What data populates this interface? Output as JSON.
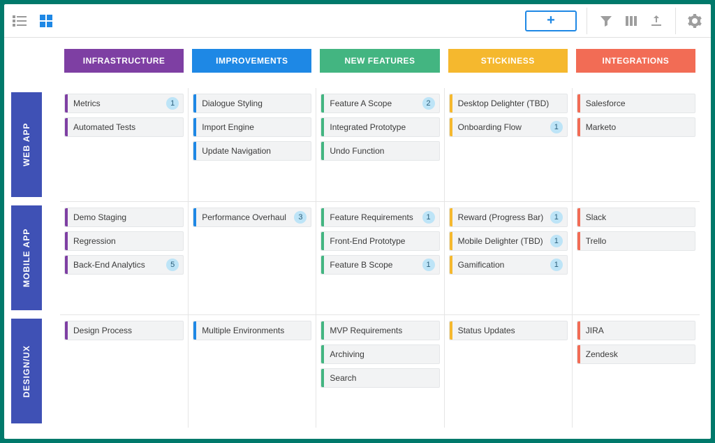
{
  "colors": {
    "infrastructure": "#7e3fa3",
    "improvements": "#1e88e5",
    "newfeatures": "#43b581",
    "stickiness": "#f5b82e",
    "integrations": "#f26c55",
    "rowHeader": "#3f51b5",
    "badgeBg": "#bde4f7"
  },
  "toolbar": {
    "add_label": "+"
  },
  "columns": [
    {
      "id": "infrastructure",
      "label": "INFRASTRUCTURE"
    },
    {
      "id": "improvements",
      "label": "IMPROVEMENTS"
    },
    {
      "id": "newfeatures",
      "label": "NEW FEATURES"
    },
    {
      "id": "stickiness",
      "label": "STICKINESS"
    },
    {
      "id": "integrations",
      "label": "INTEGRATIONS"
    }
  ],
  "rows": [
    {
      "id": "webapp",
      "label": "WEB APP"
    },
    {
      "id": "mobileapp",
      "label": "MOBILE APP"
    },
    {
      "id": "designux",
      "label": "DESIGN/UX"
    }
  ],
  "cards": {
    "webapp": {
      "infrastructure": [
        {
          "label": "Metrics",
          "badge": "1"
        },
        {
          "label": "Automated Tests"
        }
      ],
      "improvements": [
        {
          "label": "Dialogue Styling"
        },
        {
          "label": "Import Engine"
        },
        {
          "label": "Update Navigation"
        }
      ],
      "newfeatures": [
        {
          "label": "Feature A Scope",
          "badge": "2"
        },
        {
          "label": "Integrated Prototype"
        },
        {
          "label": "Undo Function"
        }
      ],
      "stickiness": [
        {
          "label": "Desktop Delighter (TBD)"
        },
        {
          "label": "Onboarding Flow",
          "badge": "1"
        }
      ],
      "integrations": [
        {
          "label": "Salesforce"
        },
        {
          "label": "Marketo"
        }
      ]
    },
    "mobileapp": {
      "infrastructure": [
        {
          "label": "Demo Staging"
        },
        {
          "label": "Regression"
        },
        {
          "label": "Back-End Analytics",
          "badge": "5"
        }
      ],
      "improvements": [
        {
          "label": "Performance Overhaul",
          "badge": "3"
        }
      ],
      "newfeatures": [
        {
          "label": "Feature Requirements",
          "badge": "1"
        },
        {
          "label": "Front-End Prototype"
        },
        {
          "label": "Feature B Scope",
          "badge": "1"
        }
      ],
      "stickiness": [
        {
          "label": "Reward (Progress Bar)",
          "badge": "1"
        },
        {
          "label": "Mobile Delighter (TBD)",
          "badge": "1"
        },
        {
          "label": "Gamification",
          "badge": "1"
        }
      ],
      "integrations": [
        {
          "label": "Slack"
        },
        {
          "label": "Trello"
        }
      ]
    },
    "designux": {
      "infrastructure": [
        {
          "label": "Design Process"
        }
      ],
      "improvements": [
        {
          "label": "Multiple Environments"
        }
      ],
      "newfeatures": [
        {
          "label": "MVP Requirements"
        },
        {
          "label": "Archiving"
        },
        {
          "label": "Search"
        }
      ],
      "stickiness": [
        {
          "label": "Status Updates"
        }
      ],
      "integrations": [
        {
          "label": "JIRA"
        },
        {
          "label": "Zendesk"
        }
      ]
    }
  }
}
